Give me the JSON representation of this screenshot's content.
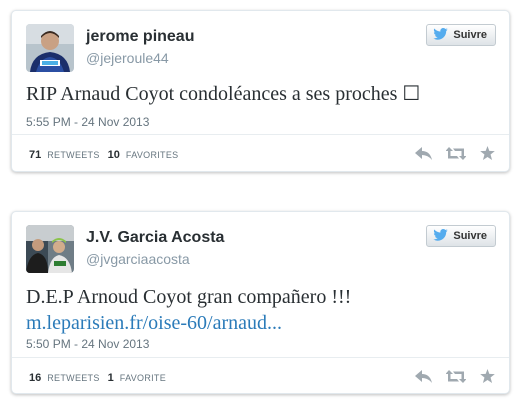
{
  "tweets": [
    {
      "display_name": "jerome pineau",
      "screen_name": "@jejeroule44",
      "follow_label": "Suivre",
      "text": "RIP Arnaud Coyot condoléances a ses proches ☐",
      "link": "",
      "timestamp": "5:55 PM - 24 Nov 2013",
      "retweets_count": "71",
      "retweets_label": "RETWEETS",
      "favorites_count": "10",
      "favorites_label": "FAVORITES"
    },
    {
      "display_name": "J.V. Garcia Acosta",
      "screen_name": "@jvgarciaacosta",
      "follow_label": "Suivre",
      "text": "D.E.P Arnoud Coyot gran compañero !!!",
      "link": "m.leparisien.fr/oise-60/arnaud...",
      "timestamp": "5:50 PM - 24 Nov 2013",
      "retweets_count": "16",
      "retweets_label": "RETWEETS",
      "favorites_count": "1",
      "favorites_label": "FAVORITE"
    }
  ],
  "colors": {
    "link": "#2b7bb9",
    "twitter_bird": "#55acee",
    "muted": "#8899a6",
    "action_icon": "#a0a9b0"
  },
  "icons": [
    "twitter-bird-icon",
    "reply-icon",
    "retweet-icon",
    "favorite-star-icon"
  ]
}
